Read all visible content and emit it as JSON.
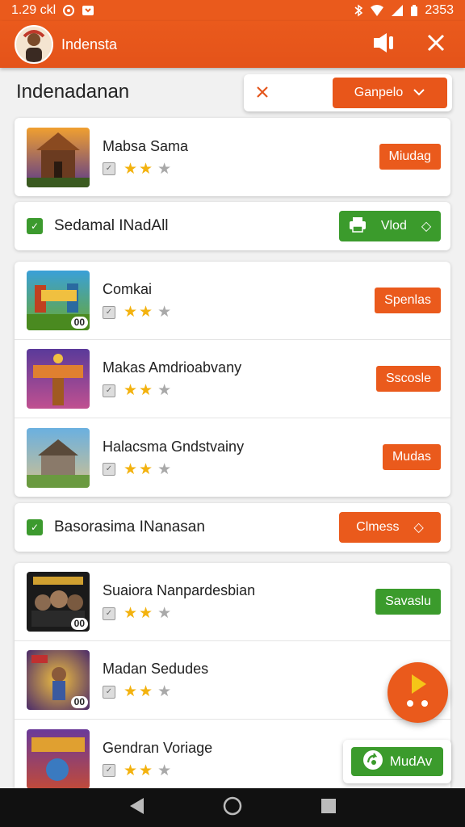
{
  "status": {
    "time": "1.29 ckl",
    "battery_pct": "2353"
  },
  "appbar": {
    "title": "Indensta"
  },
  "page": {
    "heading": "Indenadanan",
    "filter": {
      "clear_icon": "close-icon",
      "dropdown_label": "Ganpelo"
    }
  },
  "group1": [
    {
      "name": "Mabsa Sama",
      "badge": "",
      "action": "Miudag",
      "action_color": "#ea5a1c",
      "rating": 2
    }
  ],
  "section1": {
    "label": "Sedamal INadAll",
    "button": "Vlod",
    "button_color": "#3b9b2c"
  },
  "group2": [
    {
      "name": "Comkai",
      "badge": "00",
      "action": "Spenlas",
      "rating": 2
    },
    {
      "name": "Makas Amdrioabvany",
      "badge": "",
      "action": "Sscosle",
      "rating": 2
    },
    {
      "name": "Halacsma Gndstvainy",
      "badge": "",
      "action": "Mudas",
      "rating": 2
    }
  ],
  "section2": {
    "label": "Basorasima INanasan",
    "button": "Clmess",
    "button_color": "#ea5a1c"
  },
  "group3": [
    {
      "name": "Suaiora Nanpardesbian",
      "badge": "00",
      "action": "Savaslu",
      "rating": 2
    },
    {
      "name": "Madan Sedudes",
      "badge": "00",
      "action": "",
      "rating": 2
    },
    {
      "name": "Gendran Voriage",
      "badge": "",
      "action": "",
      "rating": 2
    }
  ],
  "floating_button": {
    "label": "MudAv"
  },
  "colors": {
    "accent": "#ea5a1c",
    "green": "#3b9b2c",
    "star": "#f3b20e"
  }
}
